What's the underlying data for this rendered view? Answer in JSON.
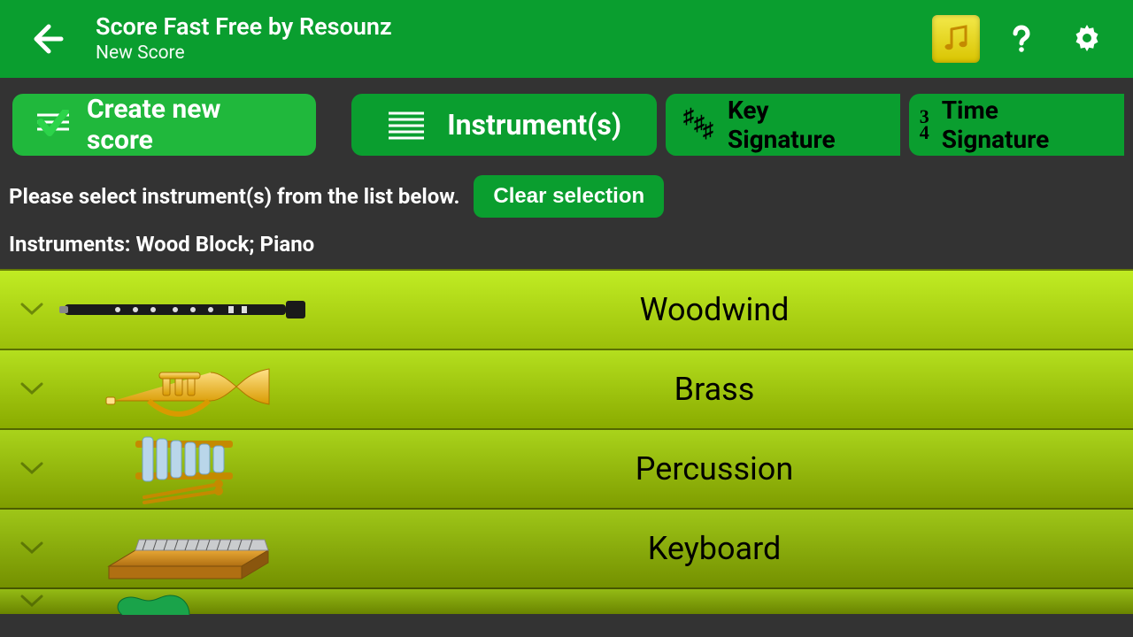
{
  "header": {
    "title": "Score Fast Free by Resounz",
    "subtitle": "New Score"
  },
  "tabs": {
    "create": "Create new score",
    "instruments": "Instrument(s)",
    "key_sig": "Key Signature",
    "time_sig": "Time Signature",
    "time_sig_icon_top": "3",
    "time_sig_icon_bottom": "4"
  },
  "instruction": "Please select instrument(s) from the list below.",
  "clear_label": "Clear selection",
  "selected_prefix": "Instruments: ",
  "selected_value": "Wood Block; Piano",
  "categories": [
    {
      "label": "Woodwind",
      "icon": "clarinet-icon"
    },
    {
      "label": "Brass",
      "icon": "trumpet-icon"
    },
    {
      "label": "Percussion",
      "icon": "xylophone-icon"
    },
    {
      "label": "Keyboard",
      "icon": "harmonium-icon"
    }
  ]
}
